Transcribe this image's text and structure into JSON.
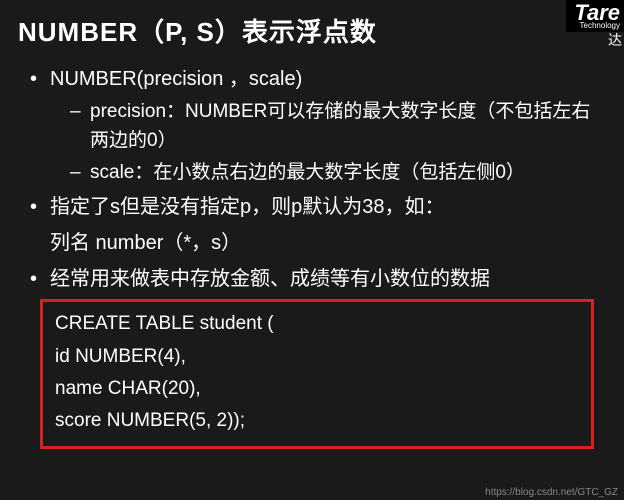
{
  "title": "NUMBER（P, S）表示浮点数",
  "logo": {
    "brand": "Tare",
    "small": "Technology",
    "sub": "达"
  },
  "bullets": {
    "b1": "NUMBER(precision ，scale)",
    "b1_sub1": "precision：NUMBER可以存储的最大数字长度（不包括左右两边的0）",
    "b1_sub2": "scale：在小数点右边的最大数字长度（包括左侧0）",
    "b2": "指定了s但是没有指定p，则p默认为38，如：",
    "b2_line": "列名 number（*，s）",
    "b3": "经常用来做表中存放金额、成绩等有小数位的数据"
  },
  "code": {
    "l1": "CREATE TABLE student (",
    "l2": "id NUMBER(4),",
    "l3": "name CHAR(20),",
    "l4": "score NUMBER(5, 2));"
  },
  "watermark": "https://blog.csdn.net/GTC_GZ"
}
